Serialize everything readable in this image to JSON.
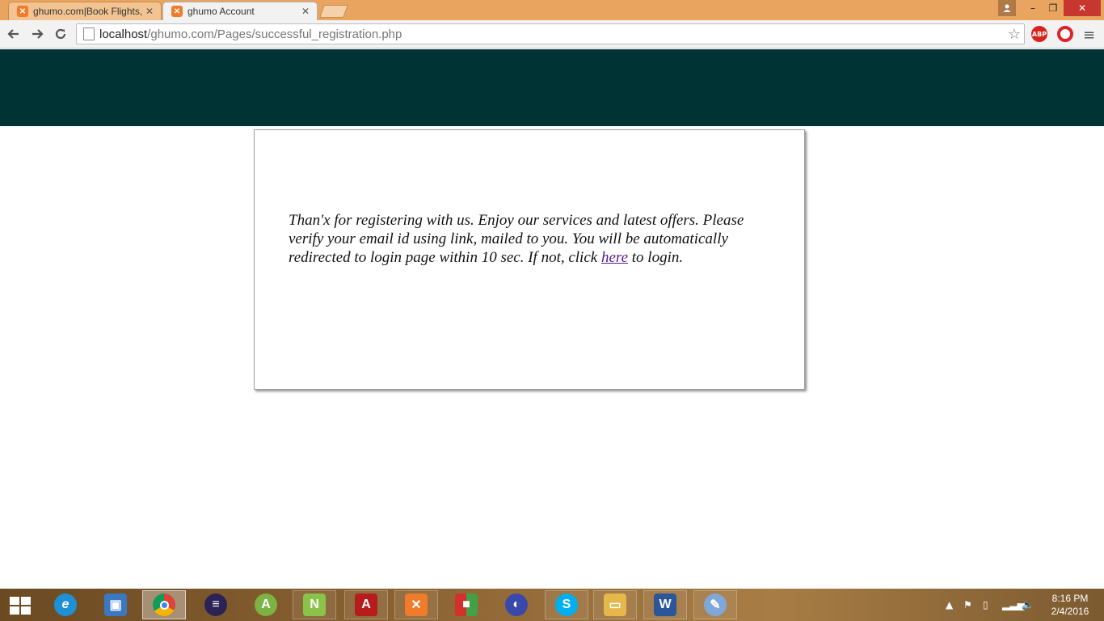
{
  "browser": {
    "tabs": [
      {
        "title": "ghumo.com|Book Flights, ",
        "close": "✕",
        "active": false
      },
      {
        "title": "ghumo Account",
        "close": "✕",
        "active": true
      }
    ],
    "window_controls": {
      "minimize": "–",
      "restore": "❐",
      "close": "✕"
    },
    "url_host": "localhost",
    "url_path": "/ghumo.com/Pages/successful_registration.php",
    "extensions": {
      "abp": "ABP"
    }
  },
  "page": {
    "message_part1": "Than'x for registering with us. Enjoy our services and latest offers. Please verify your email id using link, mailed to you. You will be automatically redirected to login page within 10 sec. If not, click ",
    "link_text": "here",
    "message_part2": " to login."
  },
  "taskbar": {
    "apps": [
      {
        "name": "internet-explorer",
        "glyph": "e",
        "color": "#1e90d6"
      },
      {
        "name": "this-pc",
        "glyph": "▣",
        "color": "#3a78c2"
      },
      {
        "name": "chrome",
        "glyph": "●",
        "color": "#db4437"
      },
      {
        "name": "eclipse",
        "glyph": "◉",
        "color": "#2c2255"
      },
      {
        "name": "android-studio",
        "glyph": "A",
        "color": "#7cb342"
      },
      {
        "name": "notepad-plus-plus",
        "glyph": "N",
        "color": "#8bc34a"
      },
      {
        "name": "adobe-reader",
        "glyph": "A",
        "color": "#b71c1c"
      },
      {
        "name": "xampp",
        "glyph": "✕",
        "color": "#f07b2b"
      },
      {
        "name": "colorful-app",
        "glyph": "■",
        "color": "#d32f2f"
      },
      {
        "name": "media-app",
        "glyph": "◐",
        "color": "#3949ab"
      },
      {
        "name": "skype",
        "glyph": "S",
        "color": "#00aff0"
      },
      {
        "name": "file-explorer",
        "glyph": "▭",
        "color": "#e6b84a"
      },
      {
        "name": "word",
        "glyph": "W",
        "color": "#2b579a"
      },
      {
        "name": "paint",
        "glyph": "✎",
        "color": "#7fa8d8"
      }
    ],
    "clock_time": "8:16 PM",
    "clock_date": "2/4/2016"
  }
}
